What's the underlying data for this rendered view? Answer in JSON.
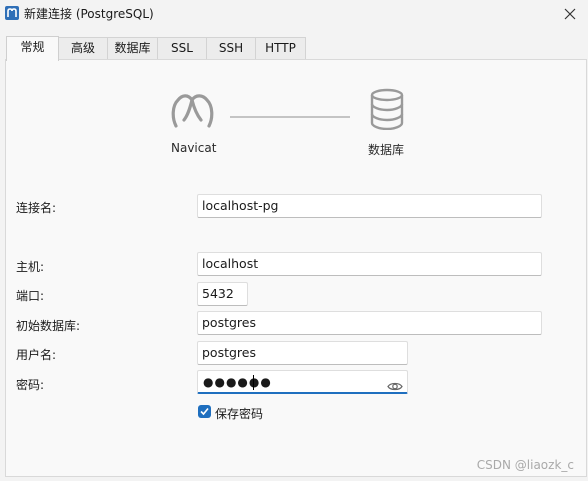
{
  "window": {
    "title": "新建连接 (PostgreSQL)",
    "icons": {
      "app": "navicat-app-icon",
      "close": "close-icon"
    }
  },
  "tabs": [
    {
      "label": "常规",
      "active": true
    },
    {
      "label": "高级"
    },
    {
      "label": "数据库"
    },
    {
      "label": "SSL"
    },
    {
      "label": "SSH"
    },
    {
      "label": "HTTP"
    }
  ],
  "diagram": {
    "client_label": "Navicat",
    "server_label": "数据库",
    "icons": {
      "client": "navicat-logo-icon",
      "server": "database-icon"
    }
  },
  "form": {
    "connection_name": {
      "label": "连接名:",
      "value": "localhost-pg"
    },
    "host": {
      "label": "主机:",
      "value": "localhost"
    },
    "port": {
      "label": "端口:",
      "value": "5432"
    },
    "initial_database": {
      "label": "初始数据库:",
      "value": "postgres"
    },
    "username": {
      "label": "用户名:",
      "value": "postgres"
    },
    "password": {
      "label": "密码:",
      "masked_value": "●●●●●●",
      "icon": "eye-icon"
    },
    "save_password": {
      "label": "保存密码",
      "checked": true
    }
  },
  "watermark": "CSDN @liaozk_c",
  "colors": {
    "accent": "#1f6fbf",
    "background": "#f3f3f3",
    "panel": "#f9f9f9"
  }
}
